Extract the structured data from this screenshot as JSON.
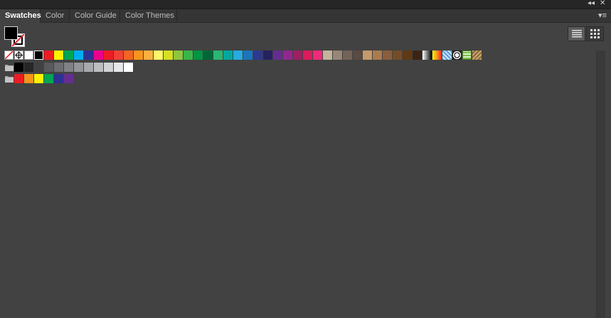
{
  "window_controls": {
    "collapse": "◂◂",
    "close": "✕"
  },
  "tabs": [
    {
      "label": "Swatches",
      "active": true
    },
    {
      "label": "Color",
      "active": false
    },
    {
      "label": "Color Guide",
      "active": false
    },
    {
      "label": "Color Themes",
      "active": false
    }
  ],
  "panel_menu_glyph": "▾≡",
  "fill_color": "#000000",
  "stroke_state": "none",
  "view_mode": "list",
  "special_swatches": [
    "none",
    "registration",
    "white",
    "black"
  ],
  "main_swatches": [
    "#ec1c24",
    "#fff200",
    "#00a651",
    "#00aeef",
    "#2e3192",
    "#ec008c",
    "#ed1c24",
    "#ef4136",
    "#f26522",
    "#f7941d",
    "#fbb040",
    "#fff568",
    "#d7df23",
    "#8dc63f",
    "#39b54a",
    "#009444",
    "#006838",
    "#2bb673",
    "#00a79d",
    "#27aae1",
    "#1c75bc",
    "#2b3990",
    "#262262",
    "#662d91",
    "#92278f",
    "#9e1f63",
    "#da1c5c",
    "#ee2a7b",
    "#c2b59b",
    "#998675",
    "#736357",
    "#594a42",
    "#c49a6c",
    "#a97c50",
    "#8b5e3c",
    "#754c29",
    "#603913",
    "#3c2415"
  ],
  "pattern_swatches": [
    "gradient-bw",
    "gradient-orange",
    "pattern-blue",
    "pattern-radial",
    "pattern-green",
    "pattern-tan"
  ],
  "grays_group": {
    "folder_icon": "folder-icon",
    "colors": [
      "#000000",
      "#262626",
      "#414042",
      "#58595b",
      "#6d6e71",
      "#808285",
      "#939598",
      "#a7a9ac",
      "#bcbec0",
      "#d1d3d4",
      "#e6e7e8",
      "#ffffff"
    ]
  },
  "brights_group": {
    "folder_icon": "folder-icon",
    "colors": [
      "#ed1c24",
      "#f7941d",
      "#fff200",
      "#00a651",
      "#2e3192",
      "#662d91"
    ]
  }
}
